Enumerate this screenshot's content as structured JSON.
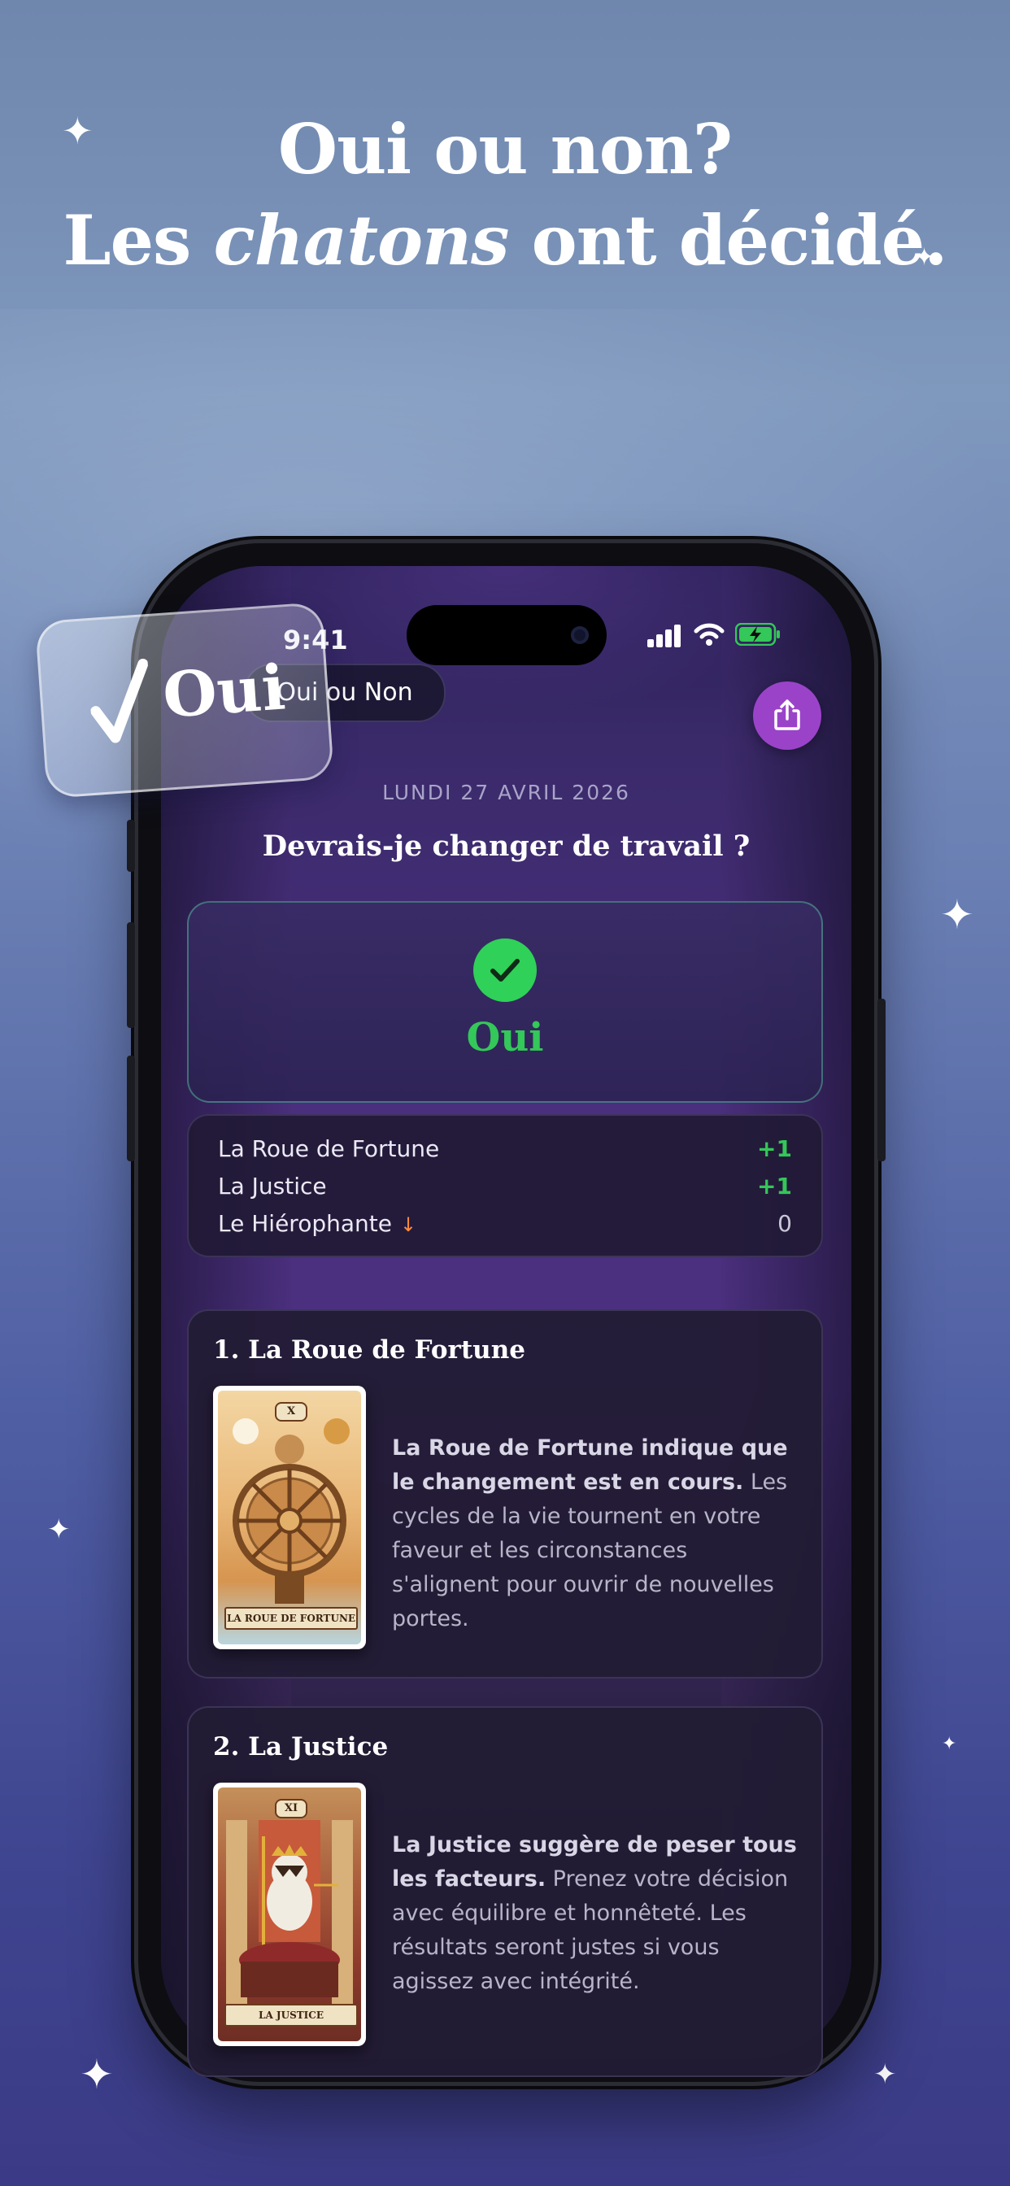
{
  "headline": {
    "line1": "Oui ou non?",
    "line2_pre": "Les ",
    "line2_em": "chatons",
    "line2_post": " ont décidé."
  },
  "badge": {
    "check": "✓",
    "label": "Oui"
  },
  "status_bar": {
    "time": "9:41"
  },
  "screen": {
    "title": "Oui ou Non",
    "share_icon": "share-icon",
    "date": "LUNDI 27 AVRIL 2026",
    "question": "Devrais-je changer de travail ?",
    "result": {
      "label": "Oui",
      "icon": "check-circle-icon",
      "color": "#34c759"
    },
    "scores": [
      {
        "name": "La Roue de Fortune",
        "value": "+1",
        "reversed": false
      },
      {
        "name": "La Justice",
        "value": "+1",
        "reversed": false
      },
      {
        "name": "Le Hiérophante",
        "value": "0",
        "reversed": true,
        "reversed_icon": "↓"
      }
    ],
    "cards": [
      {
        "title": "1. La Roue de Fortune",
        "card_number": "X",
        "card_name": "LA ROUE DE FORTUNE",
        "desc_bold": "La Roue de Fortune indique que le changement est en cours.",
        "desc_rest": " Les cycles de la vie tournent en votre faveur et les circonstances s'alignent pour ouvrir de nouvelles portes."
      },
      {
        "title": "2. La Justice",
        "card_number": "XI",
        "card_name": "LA JUSTICE",
        "desc_bold": "La Justice suggère de peser tous les facteurs.",
        "desc_rest": " Prenez votre décision avec équilibre et honnêteté. Les résultats seront justes si vous agissez avec intégrité."
      }
    ]
  },
  "colors": {
    "accent_purple": "#9a43c9",
    "positive": "#34c759",
    "reversed_arrow": "#ff8a3d"
  }
}
